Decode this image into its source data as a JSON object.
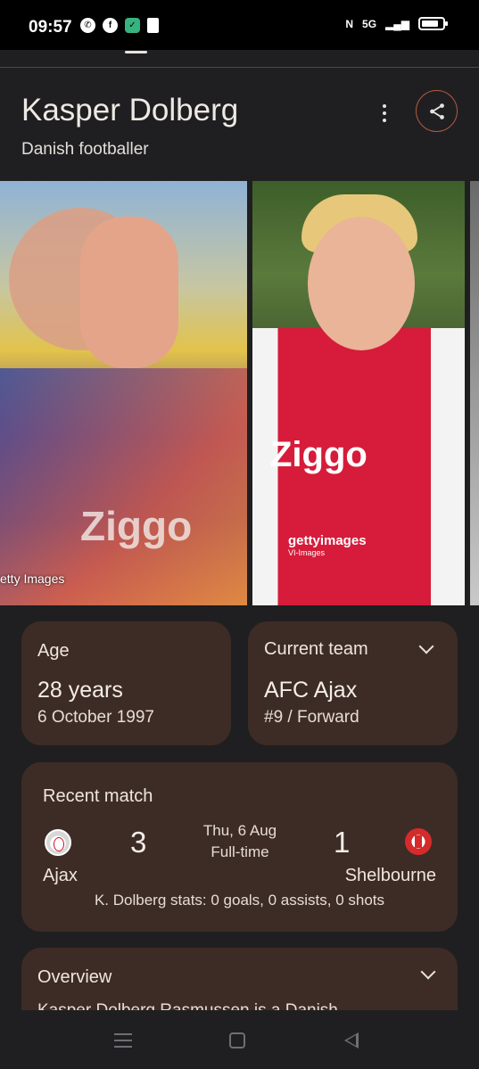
{
  "status_bar": {
    "time": "09:57",
    "icons": [
      "whatsapp-icon",
      "facebook-icon",
      "shield-icon",
      "document-icon",
      "nfc-icon",
      "5g-signal-icon",
      "battery-icon"
    ],
    "network": "5G"
  },
  "entity": {
    "title": "Kasper Dolberg",
    "subtitle": "Danish footballer"
  },
  "gallery": {
    "images": [
      {
        "credit": "etty Images"
      },
      {
        "credit": "gettyimages",
        "credit_sub": "VI-Images",
        "jersey_text": "Ziggo"
      }
    ],
    "first_jersey_text": "Ziggo"
  },
  "age_card": {
    "label": "Age",
    "value": "28 years",
    "detail": "6 October 1997"
  },
  "team_card": {
    "label": "Current team",
    "value": "AFC Ajax",
    "detail": "#9 / Forward"
  },
  "recent_match": {
    "label": "Recent match",
    "home_team": "Ajax",
    "home_score": "3",
    "away_team": "Shelbourne",
    "away_score": "1",
    "date": "Thu, 6 Aug",
    "status": "Full-time",
    "player_stats": "K. Dolberg stats: 0 goals, 0 assists, 0 shots"
  },
  "overview": {
    "label": "Overview",
    "preview_text": "Kasper Dolberg Rasmussen is a Danish"
  },
  "colors": {
    "background": "#1f1f21",
    "card": "#3d2c25",
    "share_ring": "#b65a42"
  }
}
